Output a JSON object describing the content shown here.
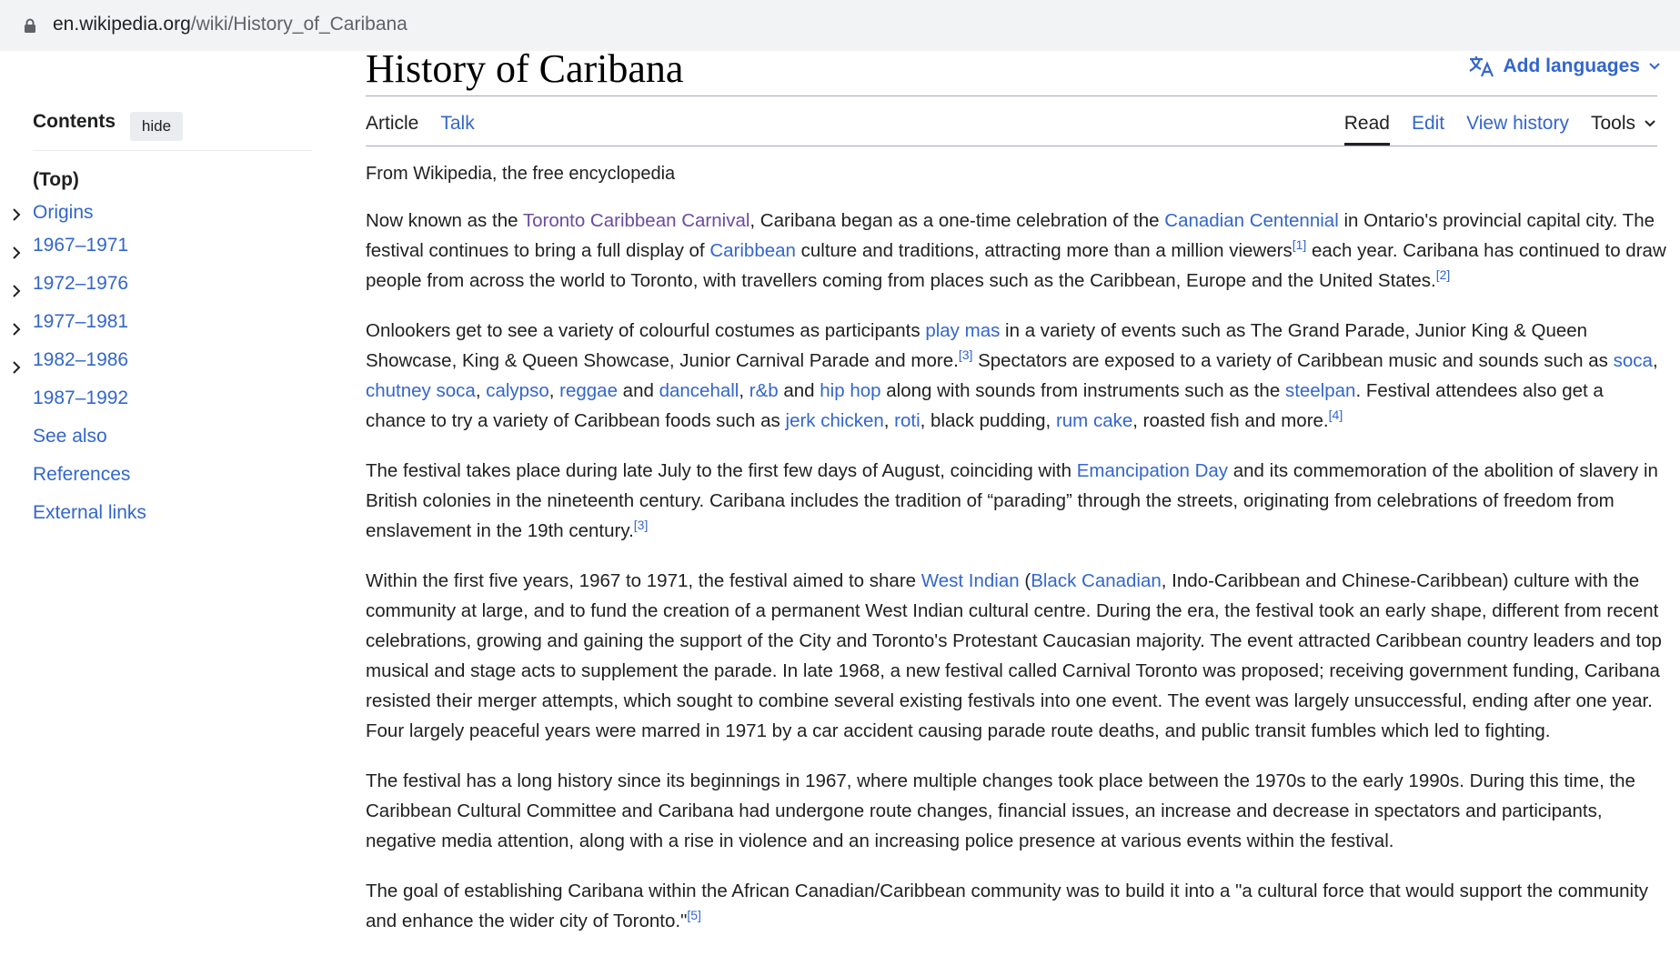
{
  "browser": {
    "url_host": "en.wikipedia.org",
    "url_path": "/wiki/History_of_Caribana"
  },
  "toc": {
    "heading": "Contents",
    "hide_label": "hide",
    "items": [
      {
        "label": "(Top)"
      },
      {
        "label": "Origins"
      },
      {
        "label": "1967–1971"
      },
      {
        "label": "1972–1976"
      },
      {
        "label": "1977–1981"
      },
      {
        "label": "1982–1986"
      },
      {
        "label": "1987–1992"
      },
      {
        "label": "See also"
      },
      {
        "label": "References"
      },
      {
        "label": "External links"
      }
    ]
  },
  "page": {
    "title": "History of Caribana",
    "add_languages": "Add languages",
    "tabs_left": [
      "Article",
      "Talk"
    ],
    "tabs_right": [
      "Read",
      "Edit",
      "View history",
      "Tools"
    ],
    "tagline": "From Wikipedia, the free encyclopedia"
  },
  "paragraphs": [
    [
      {
        "t": "Now known as the "
      },
      {
        "t": "Toronto Caribbean Carnival",
        "link": true,
        "visited": true
      },
      {
        "t": ", Caribana began as a one-time celebration of the "
      },
      {
        "t": "Canadian Centennial",
        "link": true
      },
      {
        "t": " in Ontario's provincial capital city. The festival continues to bring a full display of "
      },
      {
        "t": "Caribbean",
        "link": true
      },
      {
        "t": " culture and traditions, attracting more than a million viewers"
      },
      {
        "t": "[1]",
        "sup": true
      },
      {
        "t": " each year. Caribana has continued to draw people from across the world to Toronto, with travellers coming from places such as the Caribbean, Europe and the United States."
      },
      {
        "t": "[2]",
        "sup": true
      }
    ],
    [
      {
        "t": "Onlookers get to see a variety of colourful costumes as participants "
      },
      {
        "t": "play mas",
        "link": true
      },
      {
        "t": " in a variety of events such as The Grand Parade, Junior King & Queen Showcase, King & Queen Showcase, Junior Carnival Parade and more."
      },
      {
        "t": "[3]",
        "sup": true
      },
      {
        "t": " Spectators are exposed to a variety of Caribbean music and sounds such as "
      },
      {
        "t": "soca",
        "link": true
      },
      {
        "t": ", "
      },
      {
        "t": "chutney soca",
        "link": true
      },
      {
        "t": ", "
      },
      {
        "t": "calypso",
        "link": true
      },
      {
        "t": ", "
      },
      {
        "t": "reggae",
        "link": true
      },
      {
        "t": " and "
      },
      {
        "t": "dancehall",
        "link": true
      },
      {
        "t": ", "
      },
      {
        "t": "r&b",
        "link": true
      },
      {
        "t": " and "
      },
      {
        "t": "hip hop",
        "link": true
      },
      {
        "t": " along with sounds from instruments such as the "
      },
      {
        "t": "steelpan",
        "link": true
      },
      {
        "t": ". Festival attendees also get a chance to try a variety of Caribbean foods such as "
      },
      {
        "t": "jerk chicken",
        "link": true
      },
      {
        "t": ", "
      },
      {
        "t": "roti",
        "link": true
      },
      {
        "t": ", black pudding, "
      },
      {
        "t": "rum cake",
        "link": true
      },
      {
        "t": ", roasted fish and more."
      },
      {
        "t": "[4]",
        "sup": true
      }
    ],
    [
      {
        "t": "The festival takes place during late July to the first few days of August, coinciding with "
      },
      {
        "t": "Emancipation Day",
        "link": true
      },
      {
        "t": " and its commemoration of the abolition of slavery in British colonies in the nineteenth century. Caribana includes the tradition of “parading” through the streets, originating from celebrations of freedom from enslavement in the 19th century."
      },
      {
        "t": "[3]",
        "sup": true
      }
    ],
    [
      {
        "t": "Within the first five years, 1967 to 1971, the festival aimed to share "
      },
      {
        "t": "West Indian",
        "link": true
      },
      {
        "t": " ("
      },
      {
        "t": "Black Canadian",
        "link": true
      },
      {
        "t": ", Indo-Caribbean and Chinese-Caribbean) culture with the community at large, and to fund the creation of a permanent West Indian cultural centre. During the era, the festival took an early shape, different from recent celebrations, growing and gaining the support of the City and Toronto's Protestant Caucasian majority. The event attracted Caribbean country leaders and top musical and stage acts to supplement the parade. In late 1968, a new festival called Carnival Toronto was proposed; receiving government funding, Caribana resisted their merger attempts, which sought to combine several existing festivals into one event. The event was largely unsuccessful, ending after one year. Four largely peaceful years were marred in 1971 by a car accident causing parade route deaths, and public transit fumbles which led to fighting."
      }
    ],
    [
      {
        "t": "The festival has a long history since its beginnings in 1967, where multiple changes took place between the 1970s to the early 1990s. During this time, the Caribbean Cultural Committee and Caribana had undergone route changes, financial issues, an increase and decrease in spectators and participants, negative media attention, along with a rise in violence and an increasing police presence at various events within the festival."
      }
    ],
    [
      {
        "t": "The goal of establishing Caribana within the African Canadian/Caribbean community was to build it into a \"a cultural force that would support the community and enhance the wider city of Toronto.\""
      },
      {
        "t": "[5]",
        "sup": true
      }
    ]
  ]
}
